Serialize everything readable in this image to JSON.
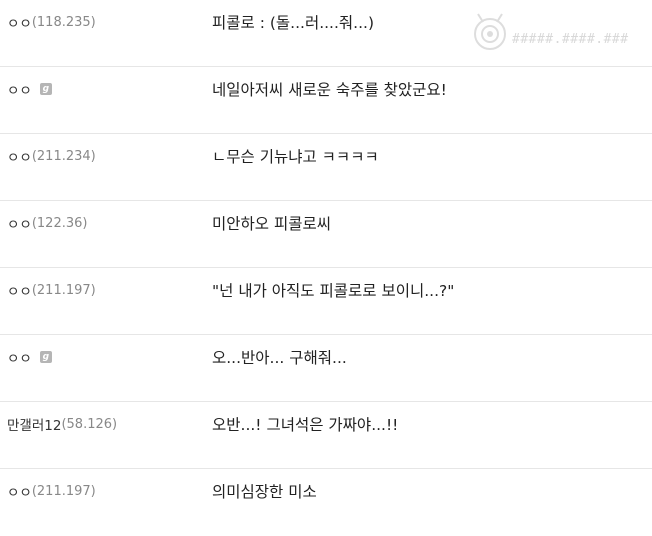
{
  "watermark": {
    "text": "#####.####.###"
  },
  "comments": [
    {
      "author": "ㅇㅇ",
      "ip": "(118.235)",
      "member": false,
      "text": "피콜로 : (돌...러....줘...)"
    },
    {
      "author": "ㅇㅇ",
      "ip": "",
      "member": true,
      "text": "네일아저씨 새로운 숙주를 찾았군요!"
    },
    {
      "author": "ㅇㅇ",
      "ip": "(211.234)",
      "member": false,
      "text": "ㄴ무슨 기뉴냐고 ㅋㅋㅋㅋ"
    },
    {
      "author": "ㅇㅇ",
      "ip": "(122.36)",
      "member": false,
      "text": "미안하오 피콜로씨"
    },
    {
      "author": "ㅇㅇ",
      "ip": "(211.197)",
      "member": false,
      "text": "\"넌 내가 아직도 피콜로로 보이니...?\""
    },
    {
      "author": "ㅇㅇ",
      "ip": "",
      "member": true,
      "text": "오...반아... 구해줘..."
    },
    {
      "author": "만갤러12",
      "ip": "(58.126)",
      "member": false,
      "text": "오반...! 그녀석은 가짜야...!!"
    },
    {
      "author": "ㅇㅇ",
      "ip": "(211.197)",
      "member": false,
      "text": "의미심장한 미소"
    }
  ],
  "badge_icon": "member-badge-icon"
}
